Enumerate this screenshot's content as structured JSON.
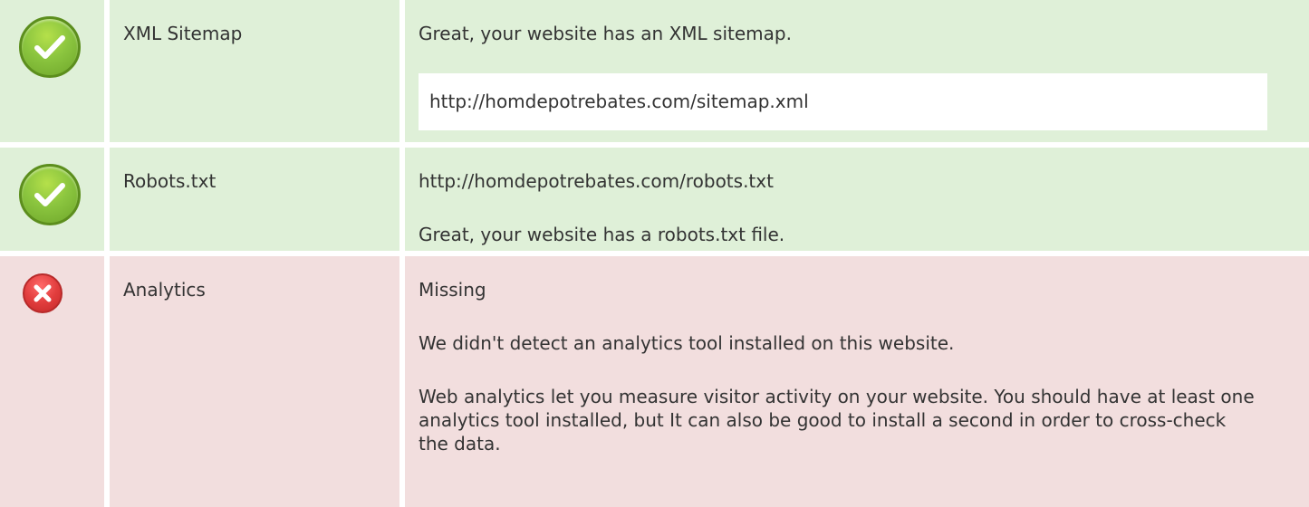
{
  "rows": [
    {
      "status": "pass",
      "status_icon": "check-icon",
      "name": "XML Sitemap",
      "message": "Great, your website has an XML sitemap.",
      "url": "http://homdepotrebates.com/sitemap.xml"
    },
    {
      "status": "pass",
      "status_icon": "check-icon",
      "name": "Robots.txt",
      "url": "http://homdepotrebates.com/robots.txt",
      "message": "Great, your website has a robots.txt file."
    },
    {
      "status": "fail",
      "status_icon": "error-icon",
      "name": "Analytics",
      "state": "Missing",
      "message": "We didn't detect an analytics tool installed on this website.",
      "detail": "Web analytics let you measure visitor activity on your website. You should have at least one analytics tool installed, but It can also be good to install a second in order to cross-check the data."
    }
  ],
  "colors": {
    "pass_background": "#dff0d8",
    "fail_background": "#f2dede",
    "pass_icon": "#8bc53f",
    "fail_icon": "#e23e3e",
    "text": "#333333"
  }
}
